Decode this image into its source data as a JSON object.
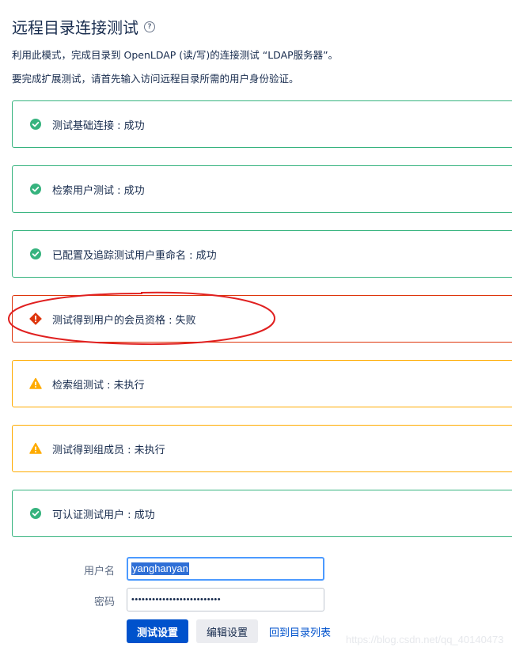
{
  "header": {
    "title": "远程目录连接测试",
    "help_icon": "?"
  },
  "description": {
    "line1": "利用此模式，完成目录到 OpenLDAP (读/写)的连接测试 “LDAP服务器”。",
    "line2": "要完成扩展测试，请首先输入访问远程目录所需的用户身份验证。"
  },
  "colors": {
    "success": "#36b37e",
    "fail": "#de350b",
    "warning": "#ffab00",
    "primary": "#0052cc",
    "annotation": "#e02020"
  },
  "results": [
    {
      "label": "测试基础连接 : 成功",
      "status": "success",
      "icon": "check-circle-icon"
    },
    {
      "label": "检索用户测试 : 成功",
      "status": "success",
      "icon": "check-circle-icon"
    },
    {
      "label": "已配置及追踪测试用户重命名 : 成功",
      "status": "success",
      "icon": "check-circle-icon"
    },
    {
      "label": "测试得到用户的会员资格 : 失败",
      "status": "fail",
      "icon": "error-diamond-icon"
    },
    {
      "label": "检索组测试 : 未执行",
      "status": "warn",
      "icon": "warning-triangle-icon"
    },
    {
      "label": "测试得到组成员 : 未执行",
      "status": "warn",
      "icon": "warning-triangle-icon"
    },
    {
      "label": "可认证测试用户 : 成功",
      "status": "success",
      "icon": "check-circle-icon"
    }
  ],
  "form": {
    "username_label": "用户名",
    "username_value": "yanghanyan",
    "password_label": "密码",
    "password_value": "••••••••••••••••••••••••••"
  },
  "actions": {
    "test_label": "测试设置",
    "edit_label": "编辑设置",
    "back_label": "回到目录列表"
  },
  "watermark": "https://blog.csdn.net/qq_40140473"
}
